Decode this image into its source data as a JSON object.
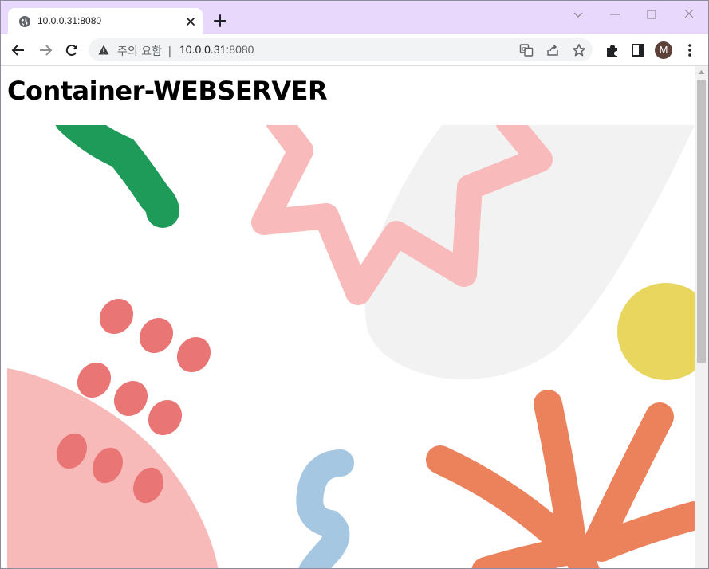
{
  "browser": {
    "tab": {
      "title": "10.0.0.31:8080",
      "favicon": "globe-icon"
    },
    "toolbar": {
      "security_label": "주의 요함",
      "separator": "|",
      "url_host": "10.0.0.31",
      "url_port": ":8080",
      "profile_initial": "M"
    },
    "colors": {
      "frame": "#e8d8fb",
      "omnibox": "#f1f3f4",
      "avatar": "#5d4037"
    }
  },
  "page": {
    "heading": "Container-WEBSERVER",
    "hero_colors": {
      "green": "#1e9b59",
      "pink_light": "#f8baba",
      "gray_blob": "#f3f2f2",
      "yellow": "#e8d65e",
      "coral_dots": "#ea7575",
      "pink_blob": "#f8b9b9",
      "blue": "#a6c7e2",
      "orange": "#ec825c"
    }
  }
}
